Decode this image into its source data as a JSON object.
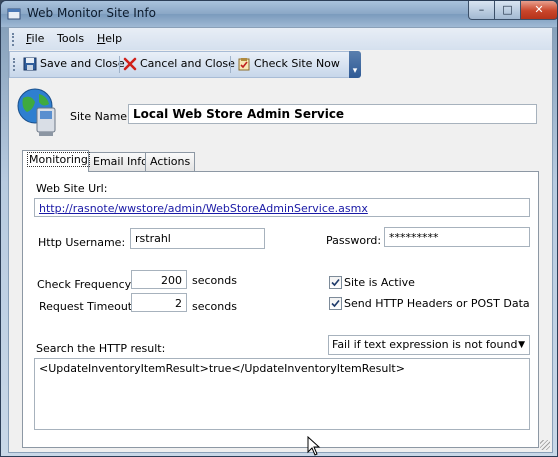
{
  "window": {
    "title": "Web Monitor Site Info",
    "controls": {
      "minimize": "–",
      "maximize": "□",
      "close": "✕"
    }
  },
  "menu": {
    "items": [
      {
        "label": "File",
        "accel": "F",
        "rest": "ile"
      },
      {
        "label": "Tools",
        "accel": "",
        "rest": "Tools"
      },
      {
        "label": "Help",
        "accel": "H",
        "rest": "elp"
      }
    ]
  },
  "toolbar": {
    "save_label": "Save and Close",
    "cancel_label": "Cancel and Close",
    "check_label": "Check Site Now",
    "save_icon": "floppy-disk-icon",
    "cancel_icon": "red-x-icon",
    "check_icon": "clipboard-check-icon"
  },
  "site": {
    "name_label": "Site Name:",
    "name_value": "Local Web Store Admin Service"
  },
  "tabs": [
    {
      "label": "Monitoring",
      "active": true
    },
    {
      "label": "Email Info",
      "active": false
    },
    {
      "label": "Actions",
      "active": false
    }
  ],
  "monitoring": {
    "url_label": "Web Site Url:",
    "url_value": "http://rasnote/wwstore/admin/WebStoreAdminService.asmx",
    "username_label": "Http Username:",
    "username_value": "rstrahl",
    "password_label": "Password:",
    "password_value": "*********",
    "check_frequency_label": "Check Frequency:",
    "check_frequency_value": "200",
    "check_frequency_unit": "seconds",
    "timeout_label": "Request Timeout:",
    "timeout_value": "2",
    "timeout_unit": "seconds",
    "site_active_label": "Site is Active",
    "site_active_checked": true,
    "send_headers_label": "Send HTTP Headers or POST Data",
    "send_headers_checked": true,
    "search_label": "Search the HTTP result:",
    "search_mode_selected": "Fail if text expression is not found",
    "search_value": "<UpdateInventoryItemResult>true</UpdateInventoryItemResult>"
  },
  "colors": {
    "title_bar": "#8aa7c6",
    "close_button": "#c9452a",
    "link": "#1a1aa6"
  }
}
